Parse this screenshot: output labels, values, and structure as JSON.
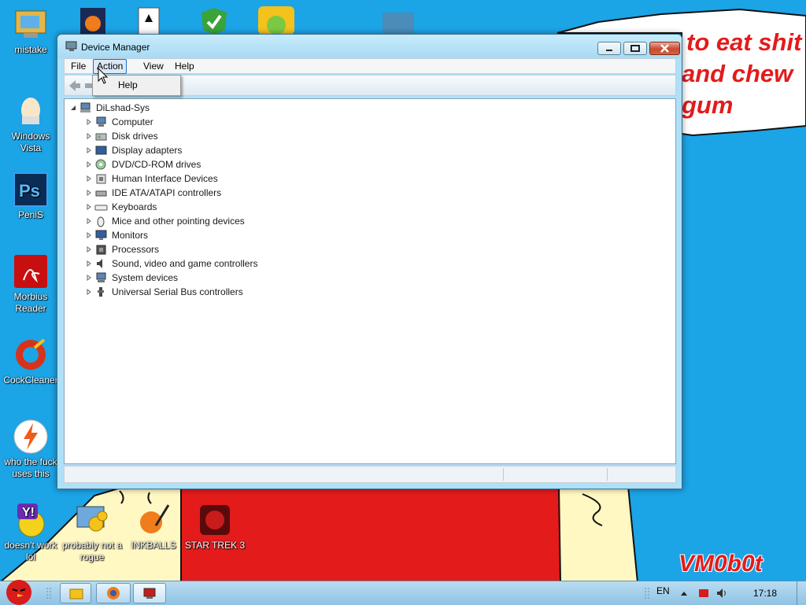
{
  "wallpaper": {
    "speech_line_1": "to eat shit",
    "speech_line_2": "and chew",
    "speech_line_3": "gum",
    "signature": "VM0b0t",
    "colors": {
      "sky": "#1ba4e6",
      "red": "#e31b1b",
      "yellow": "#fff8c2"
    }
  },
  "desktop_icons": [
    {
      "label": "mistake",
      "icon": "computer-folder-icon"
    },
    {
      "label": "Windows Vista",
      "icon": "egg-icon"
    },
    {
      "label": "PeniS",
      "icon": "photoshop-icon"
    },
    {
      "label": "Morbius Reader",
      "icon": "pdf-reader-icon"
    },
    {
      "label": "CockCleaner",
      "icon": "ccleaner-icon"
    },
    {
      "label": "who the fuck uses this",
      "icon": "lightning-icon"
    },
    {
      "label": "doesn't work lol",
      "icon": "yahoo-messenger-icon"
    },
    {
      "label": "probably not a rogue",
      "icon": "gears-monitor-icon"
    },
    {
      "label": "INKBALLS",
      "icon": "inkball-icon"
    },
    {
      "label": "STAR TREK 3",
      "icon": "star-wars-icon"
    }
  ],
  "window": {
    "title": "Device Manager",
    "menu": {
      "file": "File",
      "action": "Action",
      "view": "View",
      "help": "Help"
    },
    "dropdown": {
      "help": "Help"
    },
    "root": "DiLshad-Sys",
    "devices": [
      "Computer",
      "Disk drives",
      "Display adapters",
      "DVD/CD-ROM drives",
      "Human Interface Devices",
      "IDE ATA/ATAPI controllers",
      "Keyboards",
      "Mice and other pointing devices",
      "Monitors",
      "Processors",
      "Sound, video and game controllers",
      "System devices",
      "Universal Serial Bus controllers"
    ]
  },
  "taskbar": {
    "language": "EN",
    "clock": "17:18"
  }
}
